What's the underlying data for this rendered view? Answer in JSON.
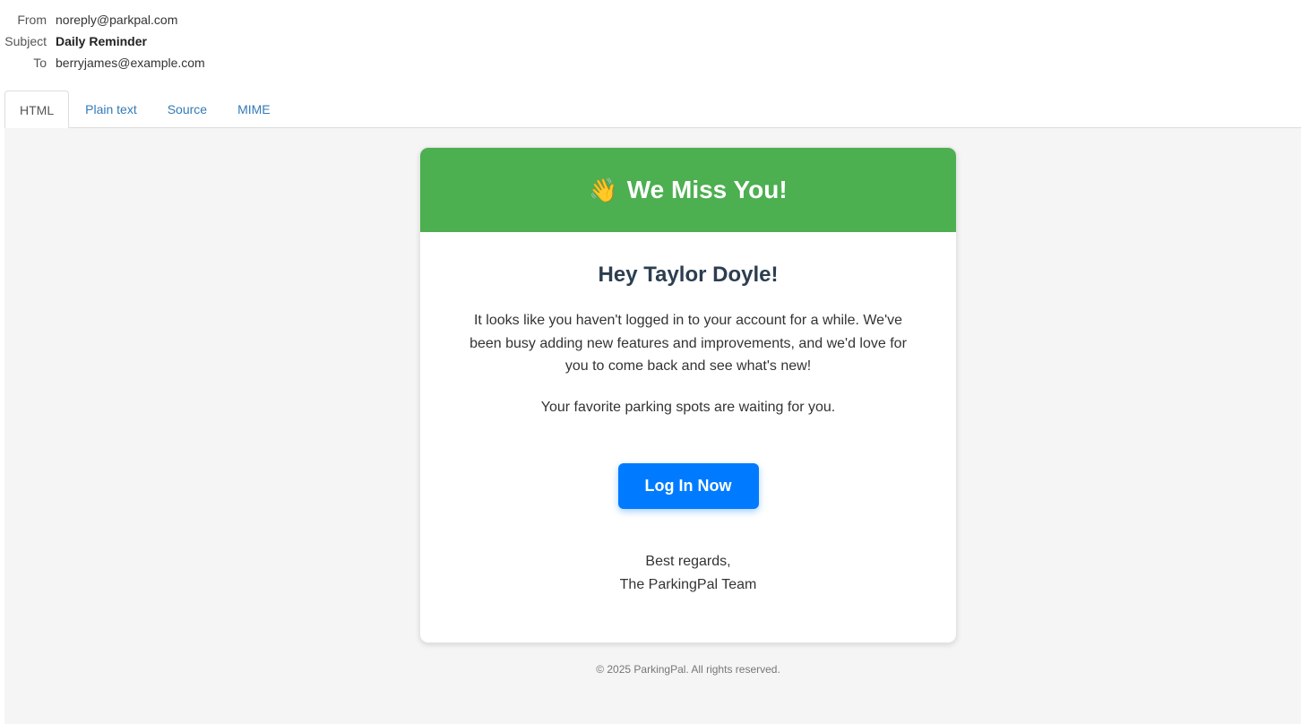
{
  "email_headers": {
    "from_label": "From",
    "from_value": "noreply@parkpal.com",
    "subject_label": "Subject",
    "subject_value": "Daily Reminder",
    "to_label": "To",
    "to_value": "berryjames@example.com"
  },
  "tabs": [
    {
      "label": "HTML",
      "active": true
    },
    {
      "label": "Plain text",
      "active": false
    },
    {
      "label": "Source",
      "active": false
    },
    {
      "label": "MIME",
      "active": false
    }
  ],
  "email": {
    "header_emoji": "👋",
    "header_title": "We Miss You!",
    "greeting": "Hey Taylor Doyle!",
    "paragraph1": "It looks like you haven't logged in to your account for a while. We've been busy adding new features and improvements, and we'd love for you to come back and see what's new!",
    "paragraph2": "Your favorite parking spots are waiting for you.",
    "button_label": "Log In Now",
    "signoff_line1": "Best regards,",
    "signoff_line2": "The ParkingPal Team",
    "footer": "© 2025 ParkingPal. All rights reserved."
  },
  "colors": {
    "header_green": "#4caf50",
    "button_blue": "#007bff",
    "greeting_color": "#2c3e50",
    "link_blue": "#337ab7"
  }
}
